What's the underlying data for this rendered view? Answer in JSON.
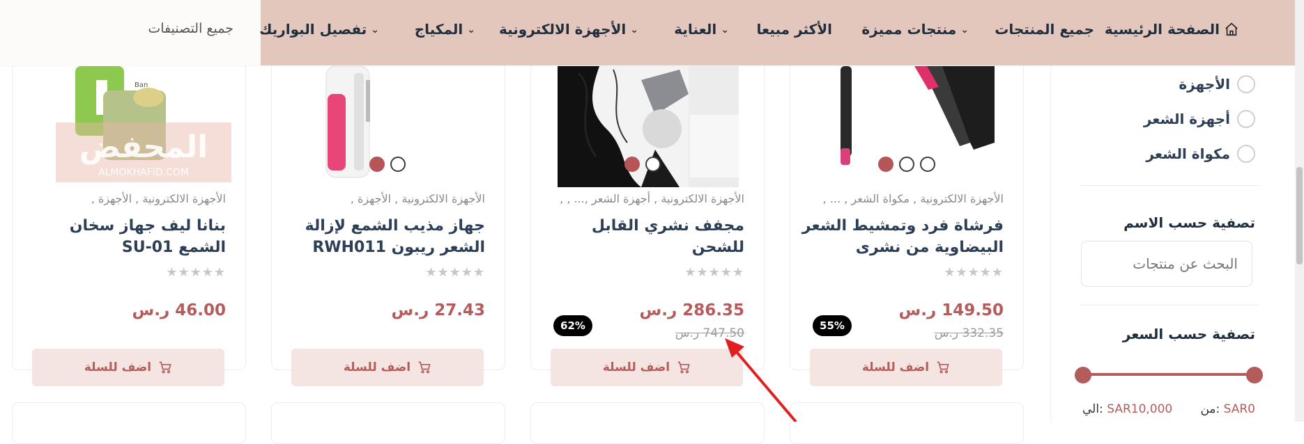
{
  "nav": {
    "home": "الصفحة الرئيسية",
    "all_products": "جميع المنتجات",
    "featured": "منتجات مميزة",
    "best_selling": "الأكثر مبيعا",
    "care": "العناية",
    "electronics": "الأجهزة الالكترونية",
    "makeup": "المكياج",
    "wig_detailing": "تفصيل البواريك",
    "all_categories": "جميع التصنيفات"
  },
  "sidebar": {
    "options": [
      "الأجهزة",
      "أجهزة الشعر",
      "مكواة الشعر"
    ],
    "filter_by_name": "تصفية حسب الاسم",
    "search_placeholder": "البحث عن منتجات",
    "filter_by_price": "تصفية حسب السعر",
    "price_from_label": "من:",
    "price_from_value": "SAR0",
    "price_to_label": "الي:",
    "price_to_value": "SAR10,000",
    "range_min_fraction": 0,
    "range_max_fraction": 1
  },
  "products": [
    {
      "categories": "الأجهزة الالكترونية , مكواة الشعر , ... ,",
      "title": "فرشاة فرد وتمشيط الشعر البيضاوية من نشرى",
      "rating": "★★★★★",
      "price": "149.50 ر.س",
      "old_price": "332.35 ر.س",
      "discount": "55%",
      "add_to_cart": "اضف للسلة"
    },
    {
      "categories": "الأجهزة الالكترونية , أجهزة الشعر ,... , ,",
      "title": "مجفف نشري القابل للشحن",
      "rating": "★★★★★",
      "price": "286.35 ر.س",
      "old_price": "747.50 ر.س",
      "discount": "62%",
      "add_to_cart": "اضف للسلة"
    },
    {
      "categories": "الأجهزة الالكترونية , الأجهزة ,",
      "title": "جهاز مذيب الشمع لإزالة الشعر ريبون RWH011",
      "rating": "★★★★★",
      "price": "27.43 ر.س",
      "add_to_cart": "اضف للسلة"
    },
    {
      "categories": "الأجهزة الالكترونية , الأجهزة ,",
      "title": "بنانا ليف جهاز سخان الشمع SU-01",
      "rating": "★★★★★",
      "price": "46.00 ر.س",
      "add_to_cart": "اضف للسلة"
    }
  ],
  "watermark": {
    "text_ar": "المحفض",
    "text_en": "ALMOKHAFID.COM"
  },
  "colors": {
    "brand": "#b45c5c",
    "nav_bg": "#e4c7bc",
    "button_bg": "#f4e5e2",
    "arrow": "#e02020"
  }
}
